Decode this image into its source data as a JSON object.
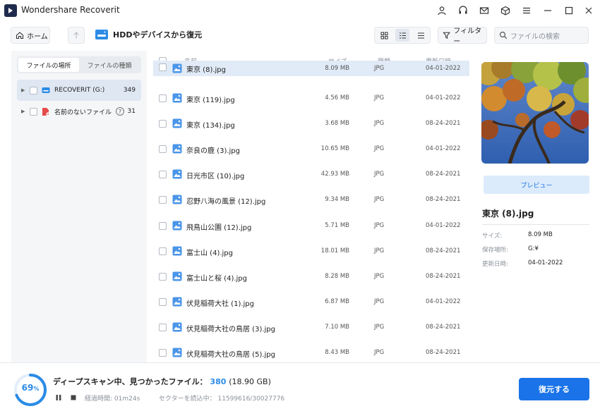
{
  "app": {
    "title": "Wondershare Recoverit"
  },
  "toolbar": {
    "home_label": "ホーム",
    "location_title": "HDDやデバイスから復元",
    "filter_label": "フィルター",
    "search_placeholder": "ファイルの検索"
  },
  "sidebar": {
    "tabs": [
      "ファイルの場所",
      "ファイルの種類"
    ],
    "items": [
      {
        "label": "RECOVERIT (G:)",
        "count": "349"
      },
      {
        "label": "名前のないファイル",
        "count": "31"
      }
    ]
  },
  "list": {
    "headers": {
      "name": "名前",
      "size": "サイズ",
      "type": "種類",
      "date": "更新日時"
    },
    "rows": [
      {
        "name": "東京 (8).jpg",
        "size": "8.09 MB",
        "type": "JPG",
        "date": "04-01-2022"
      },
      {
        "name": "東京 (119).jpg",
        "size": "4.56 MB",
        "type": "JPG",
        "date": "04-01-2022"
      },
      {
        "name": "東京 (134).jpg",
        "size": "3.68 MB",
        "type": "JPG",
        "date": "08-24-2021"
      },
      {
        "name": "奈良の鹿 (3).jpg",
        "size": "10.65 MB",
        "type": "JPG",
        "date": "04-01-2022"
      },
      {
        "name": "日光市区 (10).jpg",
        "size": "42.93 MB",
        "type": "JPG",
        "date": "08-24-2021"
      },
      {
        "name": "忍野八海の風景 (12).jpg",
        "size": "9.34 MB",
        "type": "JPG",
        "date": "08-24-2021"
      },
      {
        "name": "飛鳥山公園 (12).jpg",
        "size": "5.71 MB",
        "type": "JPG",
        "date": "04-01-2022"
      },
      {
        "name": "富士山 (4).jpg",
        "size": "18.01 MB",
        "type": "JPG",
        "date": "08-24-2021"
      },
      {
        "name": "富士山と桜 (4).jpg",
        "size": "8.28 MB",
        "type": "JPG",
        "date": "08-24-2021"
      },
      {
        "name": "伏見稲荷大社 (1).jpg",
        "size": "6.87 MB",
        "type": "JPG",
        "date": "04-01-2022"
      },
      {
        "name": "伏見稲荷大社の鳥居 (3).jpg",
        "size": "7.10 MB",
        "type": "JPG",
        "date": "08-24-2021"
      },
      {
        "name": "伏見稲荷大社の鳥居 (5).jpg",
        "size": "8.43 MB",
        "type": "JPG",
        "date": "08-24-2021"
      }
    ]
  },
  "preview": {
    "button_label": "プレビュー",
    "file_name": "東京 (8).jpg",
    "props": [
      {
        "label": "サイズ:",
        "value": "8.09 MB"
      },
      {
        "label": "保存場所:",
        "value": "G:¥"
      },
      {
        "label": "更新日時:",
        "value": "04-01-2022"
      }
    ]
  },
  "scan": {
    "progress_value": "69",
    "progress_unit": "%",
    "progress_fraction": 0.69,
    "title": "ディープスキャン中、見つかったファイル：",
    "count": "380",
    "size": "(18.90 GB)",
    "elapsed": "経過時間: 01m24s",
    "sectors": "セクターを読込中： 11599616/30027776",
    "recover_label": "復元する"
  },
  "colors": {
    "accent": "#1a73e8",
    "progress": "#2b8be6"
  }
}
